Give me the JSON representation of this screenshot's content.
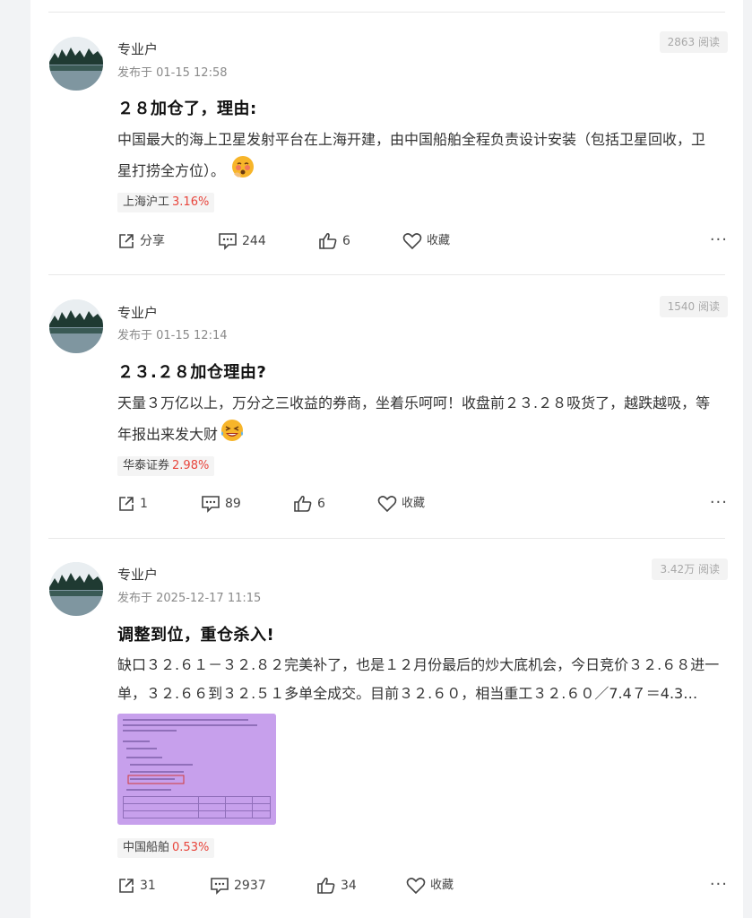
{
  "posts": [
    {
      "author": "专业户",
      "time": "发布于 01-15 12:58",
      "reads": "2863 阅读",
      "title": "２８加仓了，理由:",
      "body_lines": [
        "中国最大的海上卫星发射平台在上海开建，由中国船舶全程负责设计安装（包括卫星回收，卫",
        "星打捞全方位）。"
      ],
      "emoji_icon": "blush-face-icon",
      "stock_name": "上海沪工",
      "stock_change": "3.16%",
      "share_label": "分享",
      "comments": "244",
      "likes": "6",
      "favorite_label": "收藏",
      "more": "···"
    },
    {
      "author": "专业户",
      "time": "发布于 01-15 12:14",
      "reads": "1540 阅读",
      "title": "２３.２８加仓理由?",
      "body_lines": [
        "天量３万亿以上，万分之三收益的券商，坐着乐呵呵！收盘前２３.２８吸货了，越跌越吸，等",
        "年报出来发大财"
      ],
      "emoji_icon": "laughing-face-icon",
      "stock_name": "华泰证券",
      "stock_change": "2.98%",
      "share_label": "1",
      "comments": "89",
      "likes": "6",
      "favorite_label": "收藏",
      "more": "···"
    },
    {
      "author": "专业户",
      "time": "发布于 2025-12-17 11:15",
      "reads": "3.42万 阅读",
      "title": "调整到位，重仓杀入!",
      "body_lines": [
        "缺口３２.６１－３２.８２完美补了，也是１２月份最后的炒大底机会，今日竞价３２.６８进一",
        "单，３２.６６到３２.５１多单全成交。目前３２.６０，相当重工３２.６０／7.4７＝4.3…"
      ],
      "emoji_icon": "",
      "stock_name": "中国船舶",
      "stock_change": "0.53%",
      "share_label": "31",
      "comments": "2937",
      "likes": "34",
      "favorite_label": "收藏",
      "more": "···"
    }
  ],
  "colors": {
    "stock_up": "#e8453c",
    "reads_bg": "#f3f3f3"
  }
}
